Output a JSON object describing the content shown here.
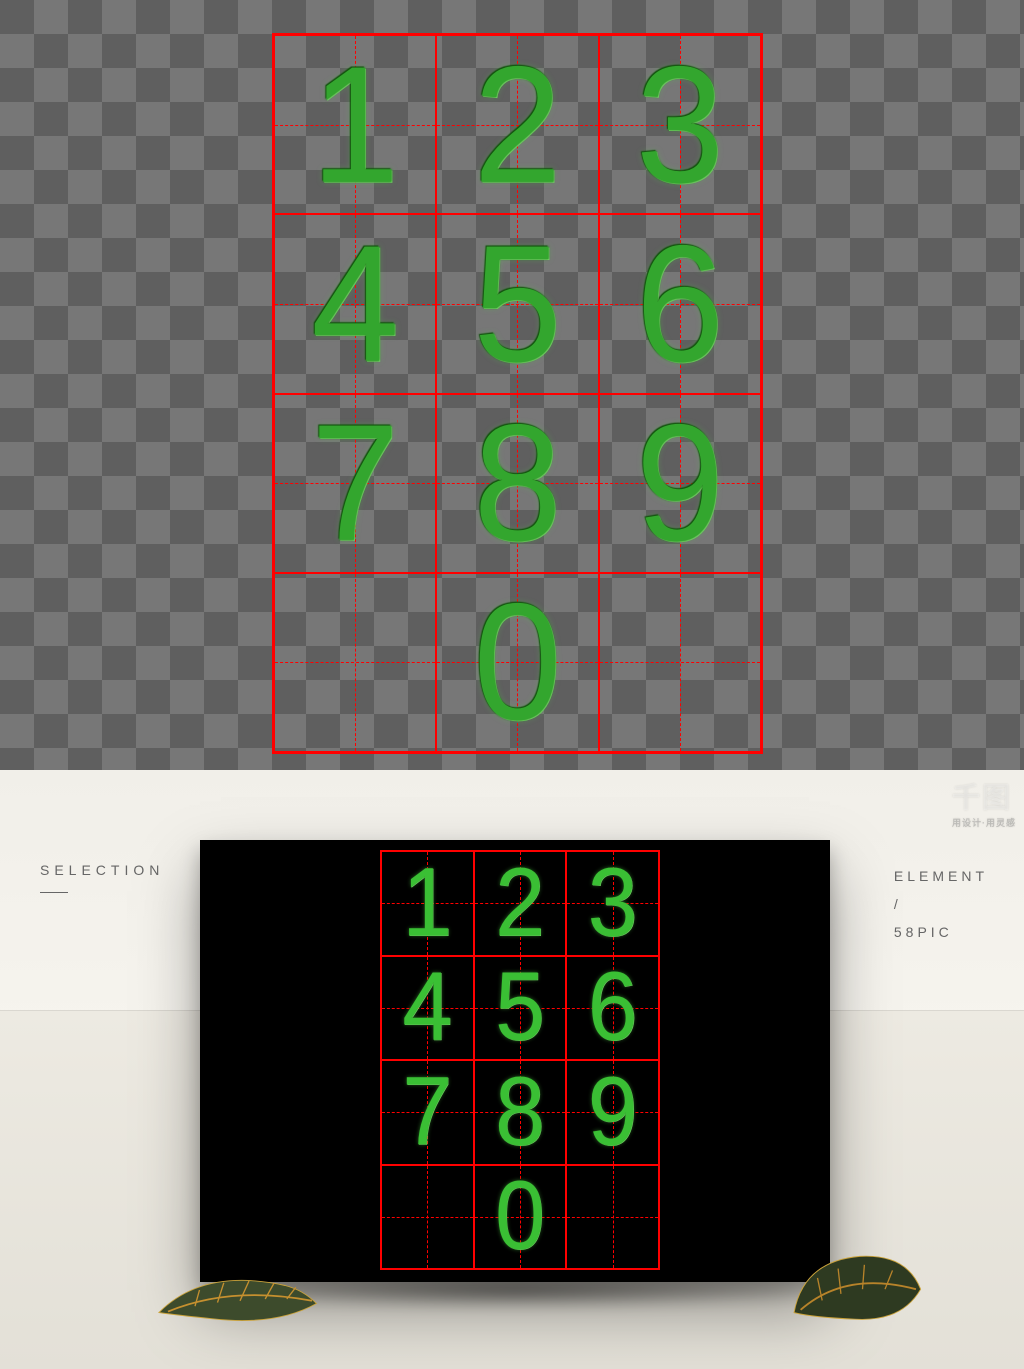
{
  "colors": {
    "grid_border": "#ff0000",
    "digit_fill": "#33a62e",
    "card_bg": "#000000",
    "checker_dark": "#5f5f5f",
    "checker_light": "#777777"
  },
  "grid": {
    "cols": 3,
    "rows": 4,
    "digits": [
      "1",
      "2",
      "3",
      "4",
      "5",
      "6",
      "7",
      "8",
      "9",
      "",
      "0",
      ""
    ]
  },
  "labels": {
    "left": "SELECTION",
    "right_line1": "ELEMENT",
    "right_line2": "/",
    "right_line3": "58PIC"
  },
  "watermark": {
    "logo": "千图",
    "tagline": "用设计·用灵感"
  }
}
